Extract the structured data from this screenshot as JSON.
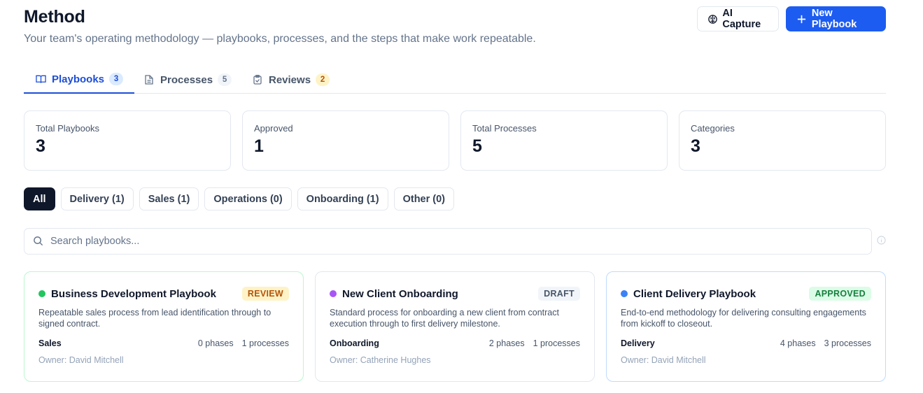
{
  "header": {
    "title": "Method",
    "subtitle": "Your team's operating methodology — playbooks, processes, and the steps that make work repeatable.",
    "ai_capture_label": "AI Capture",
    "new_playbook_label": "New Playbook"
  },
  "tabs": [
    {
      "label": "Playbooks",
      "count": "3",
      "icon": "book-open-icon",
      "active": true
    },
    {
      "label": "Processes",
      "count": "5",
      "icon": "document-icon",
      "active": false
    },
    {
      "label": "Reviews",
      "count": "2",
      "icon": "clipboard-icon",
      "active": false
    }
  ],
  "stats": [
    {
      "label": "Total Playbooks",
      "value": "3"
    },
    {
      "label": "Approved",
      "value": "1"
    },
    {
      "label": "Total Processes",
      "value": "5"
    },
    {
      "label": "Categories",
      "value": "3"
    }
  ],
  "filters": [
    "All",
    "Delivery (1)",
    "Sales (1)",
    "Operations (0)",
    "Onboarding (1)",
    "Other (0)"
  ],
  "active_filter": "All",
  "search": {
    "placeholder": "Search playbooks...",
    "value": ""
  },
  "cards": [
    {
      "title": "Business Development Playbook",
      "status": "REVIEW",
      "dot_color": "#22c55e",
      "border_color": "#bbf7d0",
      "status_bg": "#fef3c7",
      "status_color": "#b45309",
      "description": "Repeatable sales process from lead identification through to signed contract.",
      "category": "Sales",
      "phases": "0 phases",
      "processes": "1 processes",
      "owner": "Owner: David Mitchell"
    },
    {
      "title": "New Client Onboarding",
      "status": "DRAFT",
      "dot_color": "#a855f7",
      "border_color": "#e2e8f0",
      "status_bg": "#f1f5f9",
      "status_color": "#475569",
      "description": "Standard process for onboarding a new client from contract execution through to first delivery milestone.",
      "category": "Onboarding",
      "phases": "2 phases",
      "processes": "1 processes",
      "owner": "Owner: Catherine Hughes"
    },
    {
      "title": "Client Delivery Playbook",
      "status": "APPROVED",
      "dot_color": "#3b82f6",
      "border_color": "#bfdbfe",
      "status_bg": "#dcfce7",
      "status_color": "#15803d",
      "description": "End-to-end methodology for delivering consulting engagements from kickoff to closeout.",
      "category": "Delivery",
      "phases": "4 phases",
      "processes": "3 processes",
      "owner": "Owner: David Mitchell"
    }
  ]
}
